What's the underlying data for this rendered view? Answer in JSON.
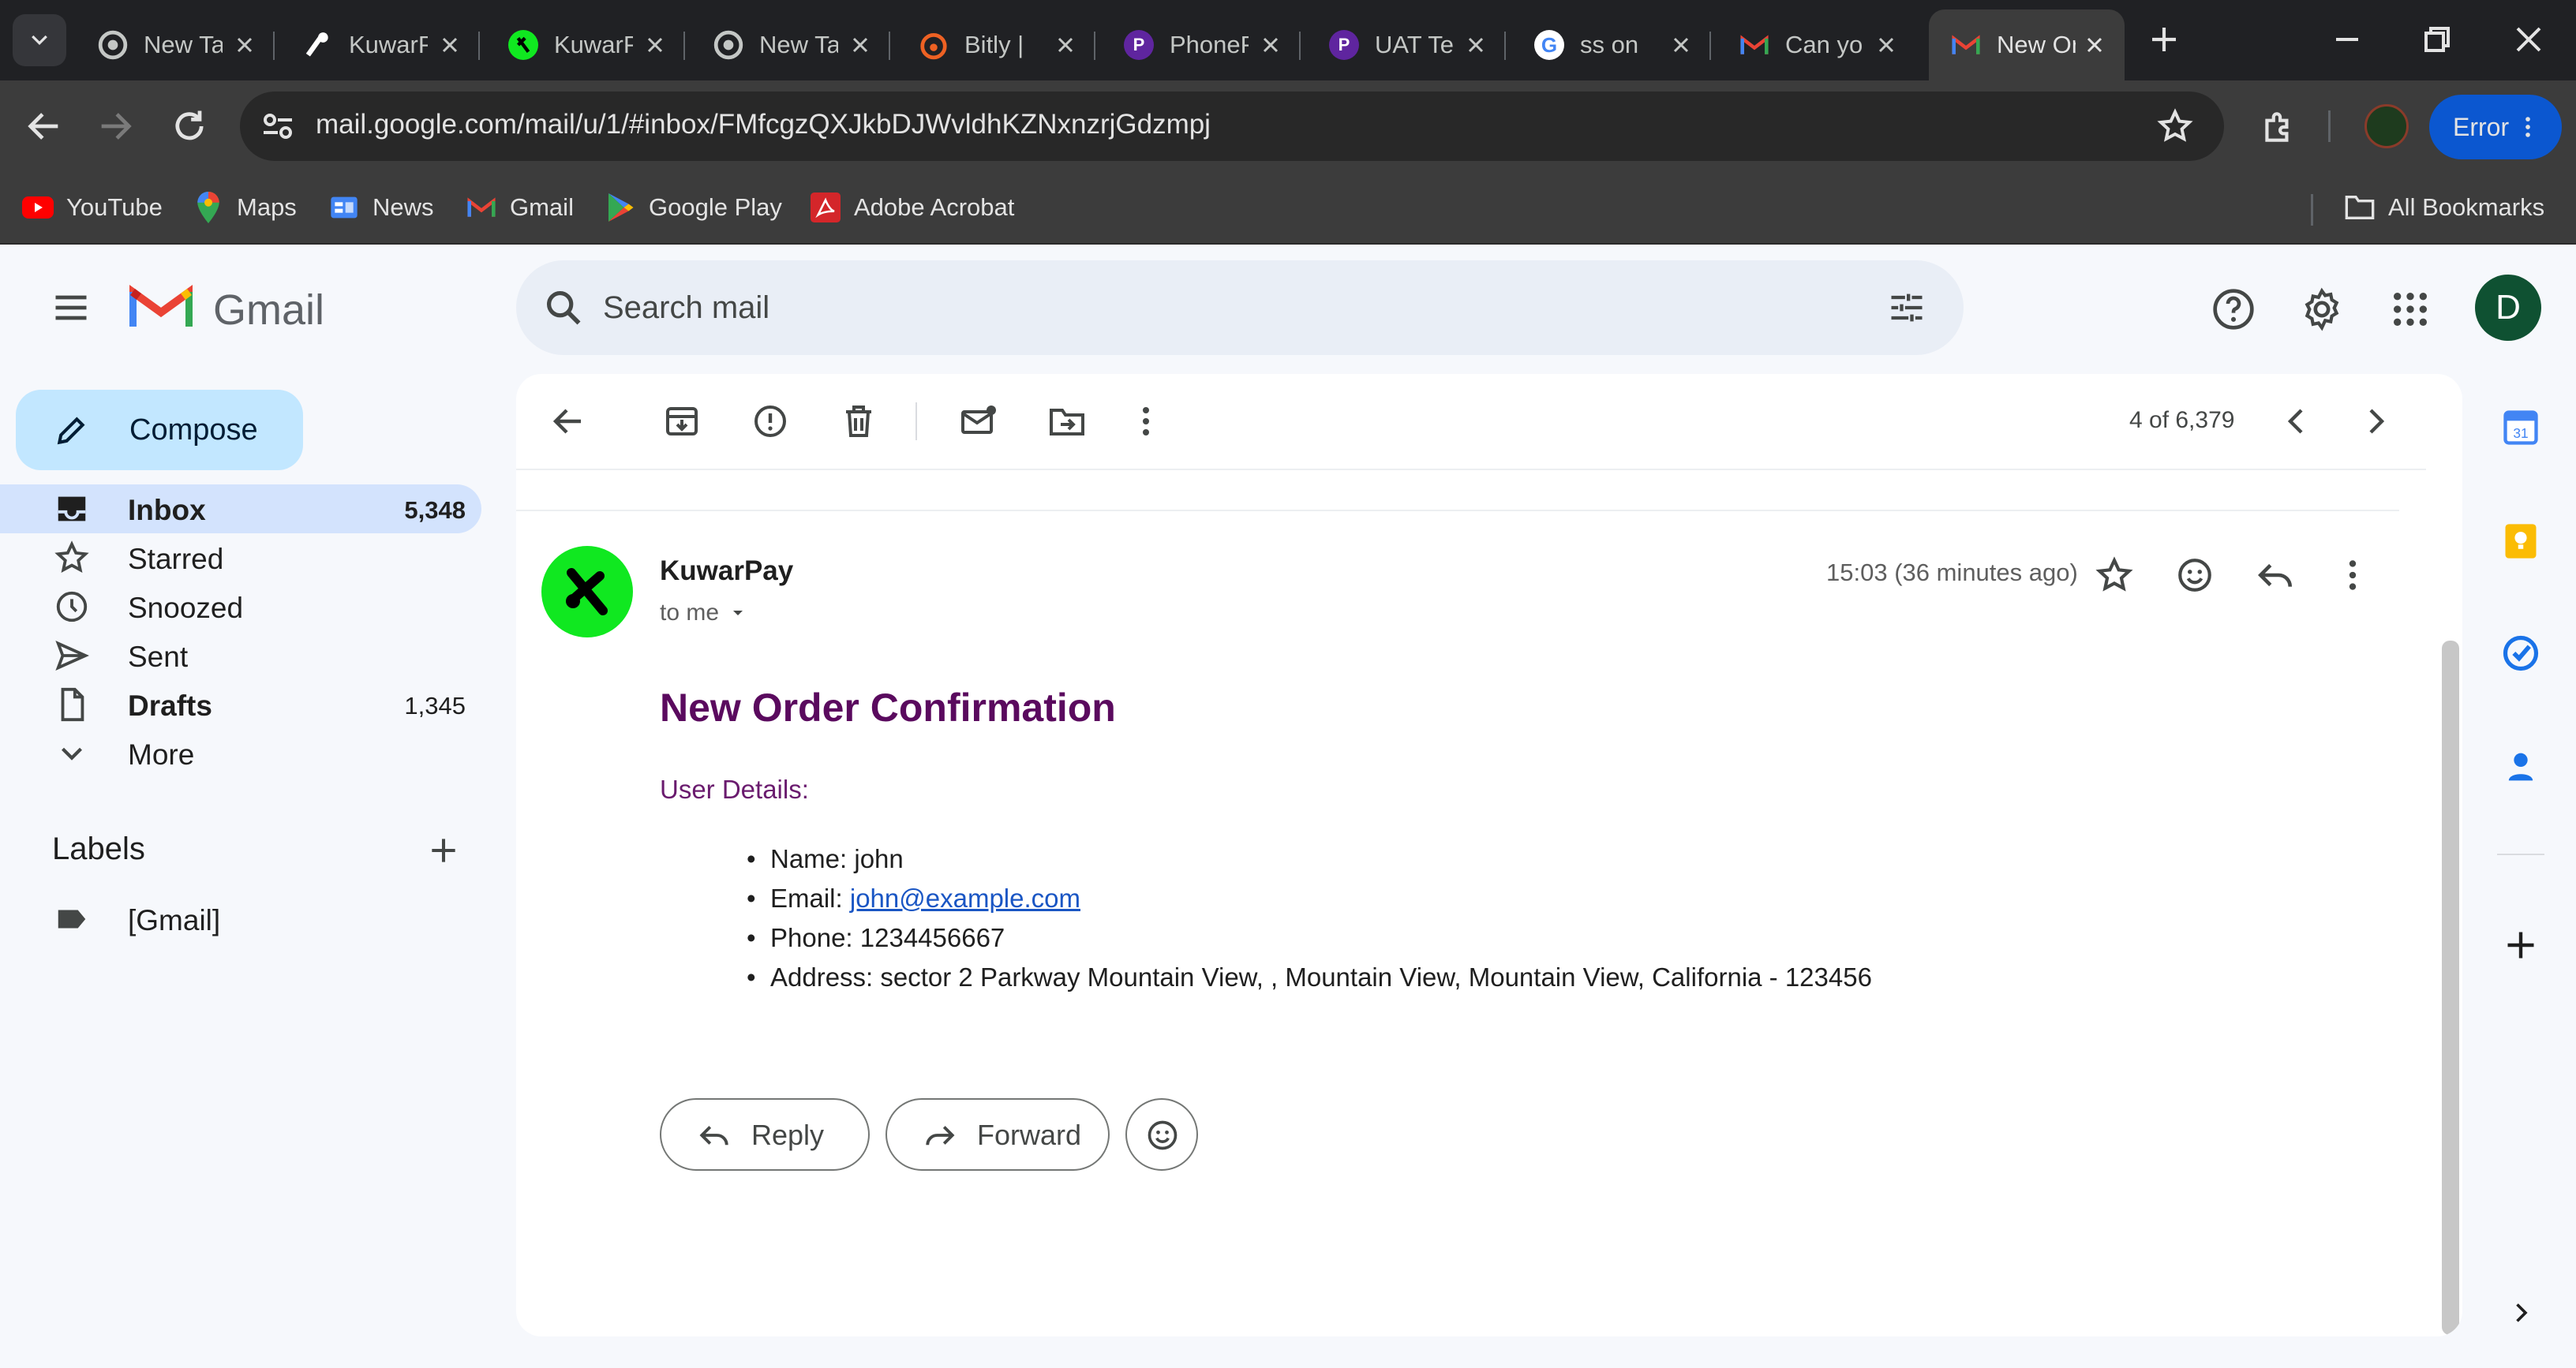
{
  "browser": {
    "tabs": [
      {
        "title": "New Tab",
        "favicon": "chrome-icon",
        "active": false
      },
      {
        "title": "KuwarPay",
        "favicon": "kuwarpay-app-icon",
        "active": false
      },
      {
        "title": "KuwarPay",
        "favicon": "kuwarpay-green-icon",
        "active": false
      },
      {
        "title": "New Tab",
        "favicon": "chrome-icon",
        "active": false
      },
      {
        "title": "Bitly | ",
        "favicon": "bitly-icon",
        "active": false
      },
      {
        "title": "PhonePe",
        "favicon": "phonepe-icon",
        "active": false
      },
      {
        "title": "UAT Test",
        "favicon": "phonepe-icon",
        "active": false
      },
      {
        "title": "ss on",
        "favicon": "google-icon",
        "active": false
      },
      {
        "title": "Can you",
        "favicon": "gmail-icon",
        "active": false
      },
      {
        "title": "New Order",
        "favicon": "gmail-icon",
        "active": true
      }
    ],
    "url": "mail.google.com/mail/u/1/#inbox/FMfcgzQXJkbDJWvldhKZNxnzrjGdzmpj",
    "error_label": "Error",
    "bookmarks": [
      {
        "label": "YouTube",
        "icon": "youtube-icon",
        "color": "#ff0000"
      },
      {
        "label": "Maps",
        "icon": "maps-icon",
        "color": "#34a853"
      },
      {
        "label": "News",
        "icon": "news-icon",
        "color": "#4285f4"
      },
      {
        "label": "Gmail",
        "icon": "gmail-icon",
        "color": "#ea4335"
      },
      {
        "label": "Google Play",
        "icon": "google-play-icon",
        "color": "#34a853"
      },
      {
        "label": "Adobe Acrobat",
        "icon": "adobe-acrobat-icon",
        "color": "#d4262a"
      }
    ],
    "all_bookmarks": "All Bookmarks"
  },
  "gmail": {
    "app_name": "Gmail",
    "search_placeholder": "Search mail",
    "avatar_initial": "D",
    "compose_label": "Compose",
    "nav": [
      {
        "label": "Inbox",
        "count": "5,348",
        "icon": "inbox-icon"
      },
      {
        "label": "Starred",
        "count": "",
        "icon": "star-icon"
      },
      {
        "label": "Snoozed",
        "count": "",
        "icon": "clock-icon"
      },
      {
        "label": "Sent",
        "count": "",
        "icon": "send-icon"
      },
      {
        "label": "Drafts",
        "count": "1,345",
        "icon": "draft-icon"
      },
      {
        "label": "More",
        "count": "",
        "icon": "chevron-down-icon"
      }
    ],
    "labels_heading": "Labels",
    "labels": [
      {
        "label": "[Gmail]",
        "icon": "label-icon"
      }
    ],
    "pager": "4 of 6,379"
  },
  "message": {
    "sender": "KuwarPay",
    "recipient": "to me",
    "time": "15:03 (36 minutes ago)",
    "title": "New Order Confirmation",
    "section": "User Details:",
    "details": {
      "name": "Name: john",
      "email_prefix": "Email: ",
      "email": "john@example.com",
      "phone": "Phone: 1234456667",
      "address": "Address: sector 2 Parkway Mountain View, , Mountain View, Mountain View, California - 123456"
    },
    "reply_label": "Reply",
    "forward_label": "Forward"
  },
  "colors": {
    "brand_green": "#10e820",
    "title_purple": "#5a0a5e",
    "accent_blue": "#0b57d0",
    "inbox_highlight": "#d3e3fd",
    "compose_bg": "#c2e7ff"
  }
}
